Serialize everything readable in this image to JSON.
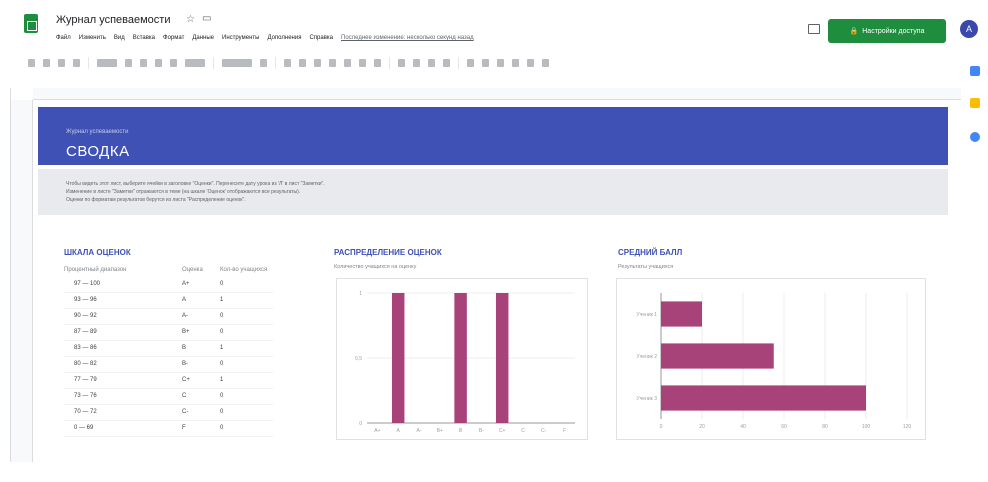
{
  "app": {
    "doc_title": "Журнал успеваемости",
    "menu": [
      "Файл",
      "Изменить",
      "Вид",
      "Вставка",
      "Формат",
      "Данные",
      "Инструменты",
      "Дополнения",
      "Справка"
    ],
    "last_edit": "Последнее изменение: несколько секунд назад",
    "share_label": "Настройки доступа",
    "avatar_letter": "A"
  },
  "banner": {
    "subtitle": "Журнал успеваемости",
    "title": "СВОДКА"
  },
  "notes": [
    "Чтобы видеть этот лист, выберите ячейки в заголовке \"Оценки\". Перенесите дату урока из 'Л' в лист \"Заметки\".",
    "Изменение в листе \"Заметки\" отражаются в теме (на шкале 'Оценок' отображаются все результаты).",
    "Оценки по форматам результатов берутся из листа \"Распределение оценок\"."
  ],
  "grades_table": {
    "title": "ШКАЛА ОЦЕНОК",
    "columns": [
      "Процентный диапазон",
      "Оценка",
      "Кол-во учащихся"
    ],
    "rows": [
      {
        "range": "97 — 100",
        "grade": "A+",
        "count": "0"
      },
      {
        "range": "93 — 96",
        "grade": "A",
        "count": "1"
      },
      {
        "range": "90 — 92",
        "grade": "A-",
        "count": "0"
      },
      {
        "range": "87 — 89",
        "grade": "B+",
        "count": "0"
      },
      {
        "range": "83 — 86",
        "grade": "B",
        "count": "1"
      },
      {
        "range": "80 — 82",
        "grade": "B-",
        "count": "0"
      },
      {
        "range": "77 — 79",
        "grade": "C+",
        "count": "1"
      },
      {
        "range": "73 — 76",
        "grade": "C",
        "count": "0"
      },
      {
        "range": "70 — 72",
        "grade": "C-",
        "count": "0"
      },
      {
        "range": "0 — 69",
        "grade": "F",
        "count": "0"
      }
    ]
  },
  "distribution": {
    "title": "РАСПРЕДЕЛЕНИЕ ОЦЕНОК",
    "subtitle": "Количество учащихся на оценку"
  },
  "average": {
    "title": "СРЕДНИЙ БАЛЛ",
    "subtitle": "Результаты учащихся"
  },
  "chart_data": [
    {
      "type": "bar",
      "title": "РАСПРЕДЕЛЕНИЕ ОЦЕНОК",
      "categories": [
        "A+",
        "A",
        "A-",
        "B+",
        "B",
        "B-",
        "C+",
        "C",
        "C-",
        "F"
      ],
      "values": [
        0,
        1,
        0,
        0,
        1,
        0,
        1,
        0,
        0,
        0
      ],
      "ylim": [
        0,
        1
      ],
      "y_ticks": [
        "0",
        "0,5",
        "1"
      ],
      "color": "#a8437a"
    },
    {
      "type": "bar",
      "orientation": "horizontal",
      "title": "СРЕДНИЙ БАЛЛ",
      "categories": [
        "Ученик 1",
        "Ученик 2",
        "Ученик 3"
      ],
      "values": [
        20,
        55,
        100
      ],
      "xlim": [
        0,
        120
      ],
      "x_ticks": [
        "0",
        "20",
        "40",
        "60",
        "80",
        "100",
        "120"
      ],
      "color": "#a8437a"
    }
  ]
}
